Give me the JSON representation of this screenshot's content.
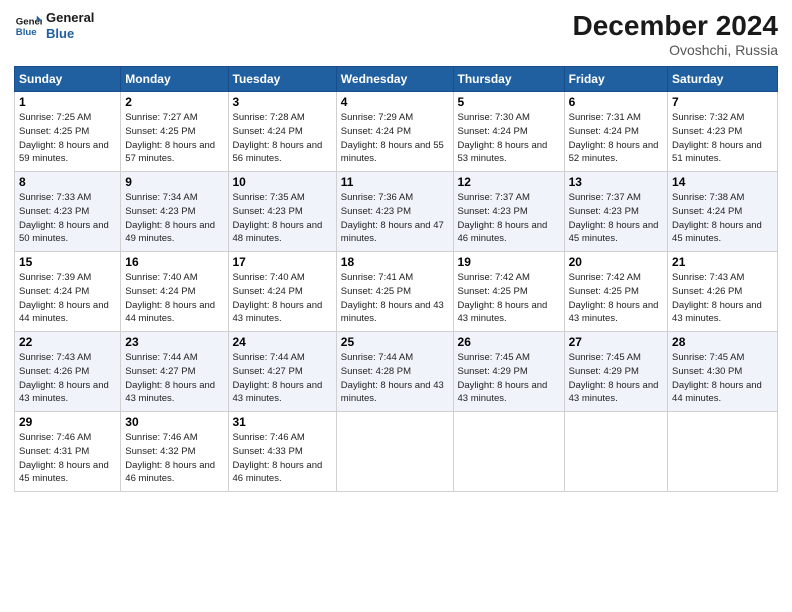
{
  "logo": {
    "line1": "General",
    "line2": "Blue"
  },
  "title": "December 2024",
  "location": "Ovoshchi, Russia",
  "days_header": [
    "Sunday",
    "Monday",
    "Tuesday",
    "Wednesday",
    "Thursday",
    "Friday",
    "Saturday"
  ],
  "weeks": [
    [
      {
        "day": "1",
        "sunrise": "Sunrise: 7:25 AM",
        "sunset": "Sunset: 4:25 PM",
        "daylight": "Daylight: 8 hours and 59 minutes."
      },
      {
        "day": "2",
        "sunrise": "Sunrise: 7:27 AM",
        "sunset": "Sunset: 4:25 PM",
        "daylight": "Daylight: 8 hours and 57 minutes."
      },
      {
        "day": "3",
        "sunrise": "Sunrise: 7:28 AM",
        "sunset": "Sunset: 4:24 PM",
        "daylight": "Daylight: 8 hours and 56 minutes."
      },
      {
        "day": "4",
        "sunrise": "Sunrise: 7:29 AM",
        "sunset": "Sunset: 4:24 PM",
        "daylight": "Daylight: 8 hours and 55 minutes."
      },
      {
        "day": "5",
        "sunrise": "Sunrise: 7:30 AM",
        "sunset": "Sunset: 4:24 PM",
        "daylight": "Daylight: 8 hours and 53 minutes."
      },
      {
        "day": "6",
        "sunrise": "Sunrise: 7:31 AM",
        "sunset": "Sunset: 4:24 PM",
        "daylight": "Daylight: 8 hours and 52 minutes."
      },
      {
        "day": "7",
        "sunrise": "Sunrise: 7:32 AM",
        "sunset": "Sunset: 4:23 PM",
        "daylight": "Daylight: 8 hours and 51 minutes."
      }
    ],
    [
      {
        "day": "8",
        "sunrise": "Sunrise: 7:33 AM",
        "sunset": "Sunset: 4:23 PM",
        "daylight": "Daylight: 8 hours and 50 minutes."
      },
      {
        "day": "9",
        "sunrise": "Sunrise: 7:34 AM",
        "sunset": "Sunset: 4:23 PM",
        "daylight": "Daylight: 8 hours and 49 minutes."
      },
      {
        "day": "10",
        "sunrise": "Sunrise: 7:35 AM",
        "sunset": "Sunset: 4:23 PM",
        "daylight": "Daylight: 8 hours and 48 minutes."
      },
      {
        "day": "11",
        "sunrise": "Sunrise: 7:36 AM",
        "sunset": "Sunset: 4:23 PM",
        "daylight": "Daylight: 8 hours and 47 minutes."
      },
      {
        "day": "12",
        "sunrise": "Sunrise: 7:37 AM",
        "sunset": "Sunset: 4:23 PM",
        "daylight": "Daylight: 8 hours and 46 minutes."
      },
      {
        "day": "13",
        "sunrise": "Sunrise: 7:37 AM",
        "sunset": "Sunset: 4:23 PM",
        "daylight": "Daylight: 8 hours and 45 minutes."
      },
      {
        "day": "14",
        "sunrise": "Sunrise: 7:38 AM",
        "sunset": "Sunset: 4:24 PM",
        "daylight": "Daylight: 8 hours and 45 minutes."
      }
    ],
    [
      {
        "day": "15",
        "sunrise": "Sunrise: 7:39 AM",
        "sunset": "Sunset: 4:24 PM",
        "daylight": "Daylight: 8 hours and 44 minutes."
      },
      {
        "day": "16",
        "sunrise": "Sunrise: 7:40 AM",
        "sunset": "Sunset: 4:24 PM",
        "daylight": "Daylight: 8 hours and 44 minutes."
      },
      {
        "day": "17",
        "sunrise": "Sunrise: 7:40 AM",
        "sunset": "Sunset: 4:24 PM",
        "daylight": "Daylight: 8 hours and 43 minutes."
      },
      {
        "day": "18",
        "sunrise": "Sunrise: 7:41 AM",
        "sunset": "Sunset: 4:25 PM",
        "daylight": "Daylight: 8 hours and 43 minutes."
      },
      {
        "day": "19",
        "sunrise": "Sunrise: 7:42 AM",
        "sunset": "Sunset: 4:25 PM",
        "daylight": "Daylight: 8 hours and 43 minutes."
      },
      {
        "day": "20",
        "sunrise": "Sunrise: 7:42 AM",
        "sunset": "Sunset: 4:25 PM",
        "daylight": "Daylight: 8 hours and 43 minutes."
      },
      {
        "day": "21",
        "sunrise": "Sunrise: 7:43 AM",
        "sunset": "Sunset: 4:26 PM",
        "daylight": "Daylight: 8 hours and 43 minutes."
      }
    ],
    [
      {
        "day": "22",
        "sunrise": "Sunrise: 7:43 AM",
        "sunset": "Sunset: 4:26 PM",
        "daylight": "Daylight: 8 hours and 43 minutes."
      },
      {
        "day": "23",
        "sunrise": "Sunrise: 7:44 AM",
        "sunset": "Sunset: 4:27 PM",
        "daylight": "Daylight: 8 hours and 43 minutes."
      },
      {
        "day": "24",
        "sunrise": "Sunrise: 7:44 AM",
        "sunset": "Sunset: 4:27 PM",
        "daylight": "Daylight: 8 hours and 43 minutes."
      },
      {
        "day": "25",
        "sunrise": "Sunrise: 7:44 AM",
        "sunset": "Sunset: 4:28 PM",
        "daylight": "Daylight: 8 hours and 43 minutes."
      },
      {
        "day": "26",
        "sunrise": "Sunrise: 7:45 AM",
        "sunset": "Sunset: 4:29 PM",
        "daylight": "Daylight: 8 hours and 43 minutes."
      },
      {
        "day": "27",
        "sunrise": "Sunrise: 7:45 AM",
        "sunset": "Sunset: 4:29 PM",
        "daylight": "Daylight: 8 hours and 43 minutes."
      },
      {
        "day": "28",
        "sunrise": "Sunrise: 7:45 AM",
        "sunset": "Sunset: 4:30 PM",
        "daylight": "Daylight: 8 hours and 44 minutes."
      }
    ],
    [
      {
        "day": "29",
        "sunrise": "Sunrise: 7:46 AM",
        "sunset": "Sunset: 4:31 PM",
        "daylight": "Daylight: 8 hours and 45 minutes."
      },
      {
        "day": "30",
        "sunrise": "Sunrise: 7:46 AM",
        "sunset": "Sunset: 4:32 PM",
        "daylight": "Daylight: 8 hours and 46 minutes."
      },
      {
        "day": "31",
        "sunrise": "Sunrise: 7:46 AM",
        "sunset": "Sunset: 4:33 PM",
        "daylight": "Daylight: 8 hours and 46 minutes."
      },
      null,
      null,
      null,
      null
    ]
  ]
}
